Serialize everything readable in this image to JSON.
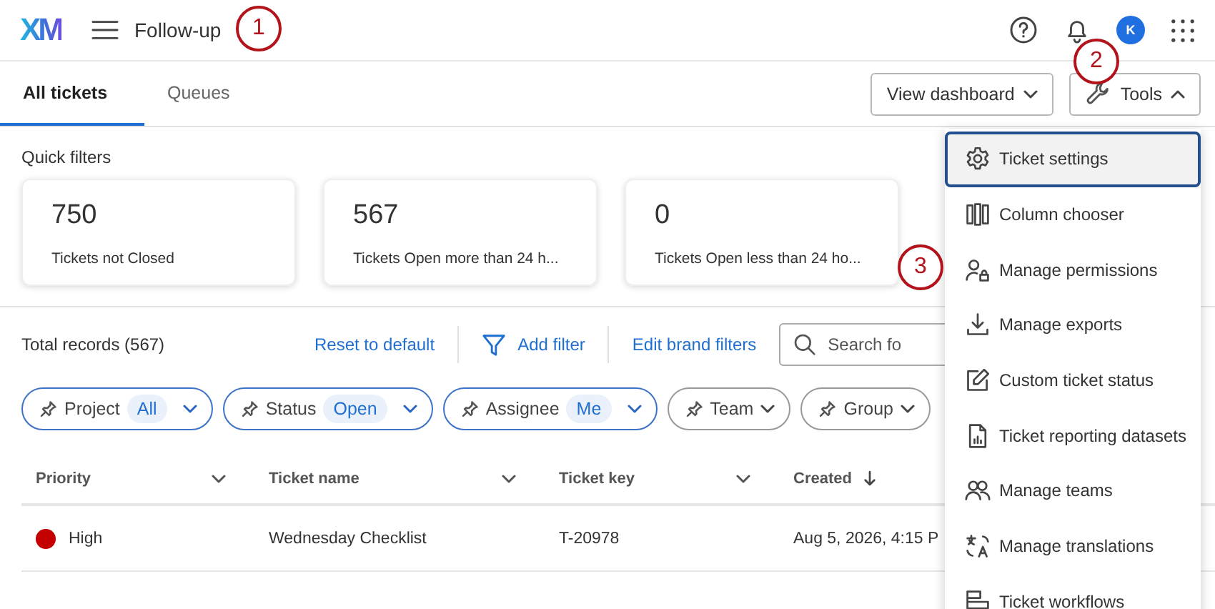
{
  "app": {
    "logo": "XM",
    "title": "Follow-up",
    "avatar": "K"
  },
  "tabs": [
    {
      "label": "All tickets",
      "selected": true
    },
    {
      "label": "Queues",
      "selected": false
    }
  ],
  "toolbar": [
    {
      "label": "View dashboard",
      "kind": "dropdown"
    },
    {
      "label": "Tools",
      "kind": "tools"
    }
  ],
  "quick_filters": {
    "title": "Quick filters",
    "cards": [
      {
        "value": "750",
        "label": "Tickets not Closed"
      },
      {
        "value": "567",
        "label": "Tickets Open more than 24 h..."
      },
      {
        "value": "0",
        "label": "Tickets Open less than 24 ho..."
      }
    ]
  },
  "records": {
    "total": "Total records (567)",
    "links": [
      {
        "label": "Reset to default",
        "kind": "plain"
      },
      {
        "label": "Add filter",
        "kind": "filter"
      },
      {
        "label": "Edit brand filters",
        "kind": "plain"
      }
    ],
    "search": {
      "placeholder": "Search fo"
    }
  },
  "filters": [
    {
      "label": "Project",
      "value": "All",
      "active": true
    },
    {
      "label": "Status",
      "value": "Open",
      "active": true
    },
    {
      "label": "Assignee",
      "value": "Me",
      "active": true
    },
    {
      "label": "Team",
      "active": false
    },
    {
      "label": "Group",
      "active": false
    }
  ],
  "table": {
    "columns": [
      {
        "label": "Priority",
        "kind": "menu"
      },
      {
        "label": "Ticket name",
        "kind": "menu"
      },
      {
        "label": "Ticket key",
        "kind": "menu"
      },
      {
        "label": "Created",
        "kind": "sorted"
      }
    ],
    "rows": [
      {
        "priority": "High",
        "color": "#c40000",
        "name": "Wednesday Checklist",
        "key": "T-20978",
        "created": "Aug 5, 2026, 4:15 P"
      }
    ]
  },
  "tools_menu": [
    {
      "label": "Ticket settings",
      "kind": "gear",
      "selected": true
    },
    {
      "label": "Column chooser",
      "kind": "columns",
      "selected": false
    },
    {
      "label": "Manage permissions",
      "kind": "permissions",
      "selected": false
    },
    {
      "label": "Manage exports",
      "kind": "export",
      "selected": false
    },
    {
      "label": "Custom ticket status",
      "kind": "edit",
      "selected": false
    },
    {
      "label": "Ticket reporting datasets",
      "kind": "report",
      "selected": false
    },
    {
      "label": "Manage teams",
      "kind": "teams",
      "selected": false
    },
    {
      "label": "Manage translations",
      "kind": "translate",
      "selected": false
    },
    {
      "label": "Ticket workflows",
      "kind": "workflow",
      "selected": false
    }
  ],
  "callouts": [
    {
      "label": "1"
    },
    {
      "label": "2"
    },
    {
      "label": "3"
    }
  ]
}
